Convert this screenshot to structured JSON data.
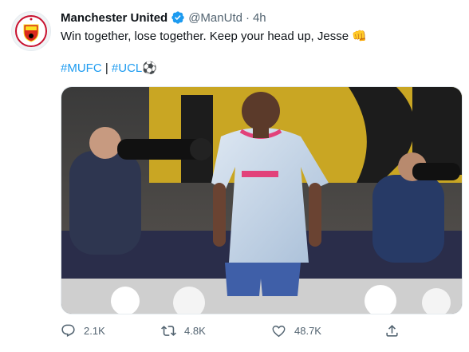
{
  "tweet": {
    "author_name": "Manchester United",
    "handle": "@ManUtd",
    "separator": "·",
    "time": "4h",
    "text": "Win together, lose together. Keep your head up, Jesse 👊",
    "hashtag_1": "#MUFC",
    "hashtag_separator": "|",
    "hashtag_2": "#UCL⚽",
    "avatar_icon": "manchester-united-crest",
    "verified_icon": "verified-badge-icon",
    "media_description": "photo"
  },
  "actions": {
    "reply_count": "2.1K",
    "retweet_count": "4.8K",
    "like_count": "48.7K",
    "reply_icon": "reply-icon",
    "retweet_icon": "retweet-icon",
    "like_icon": "heart-icon",
    "share_icon": "share-icon"
  },
  "colors": {
    "link": "#1d9bf0",
    "muted": "#536471",
    "text": "#0f1419",
    "verified": "#1d9bf0"
  }
}
